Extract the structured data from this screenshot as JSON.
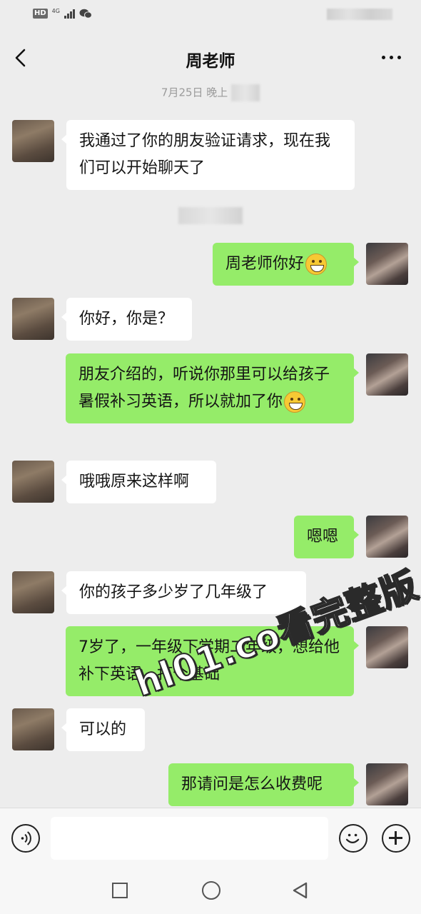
{
  "header": {
    "title": "周老师"
  },
  "chat": {
    "timestamp": "7月25日 晚上",
    "messages": [
      {
        "side": "left",
        "text": "我通过了你的朋友验证请求，现在我们可以开始聊天了"
      },
      {
        "side": "right",
        "text": "周老师你好"
      },
      {
        "side": "left",
        "text": "你好，你是？"
      },
      {
        "side": "right",
        "text": "朋友介绍的，听说你那里可以给孩子暑假补习英语，所以就加了你"
      },
      {
        "side": "left",
        "text": "哦哦原来这样啊"
      },
      {
        "side": "right",
        "text": "嗯嗯"
      },
      {
        "side": "left",
        "text": "你的孩子多少岁了几年级了"
      },
      {
        "side": "right",
        "text": "7岁了，一年级下学期二年级，想给他补下英语，打个基础"
      },
      {
        "side": "left",
        "text": "可以的"
      },
      {
        "side": "right",
        "text": "那请问是怎么收费呢"
      }
    ]
  },
  "watermark": "hl01.co看完整版",
  "icons": {
    "back": "chevron-left-icon",
    "more": "more-dots-icon",
    "voice": "voice-icon",
    "emoji": "emoji-icon",
    "plus": "plus-icon",
    "nav_recent": "square-icon",
    "nav_home": "circle-icon",
    "nav_back": "triangle-back-icon"
  },
  "colors": {
    "background": "#ededed",
    "bubble_self": "#95ec69",
    "bubble_other": "#ffffff"
  }
}
